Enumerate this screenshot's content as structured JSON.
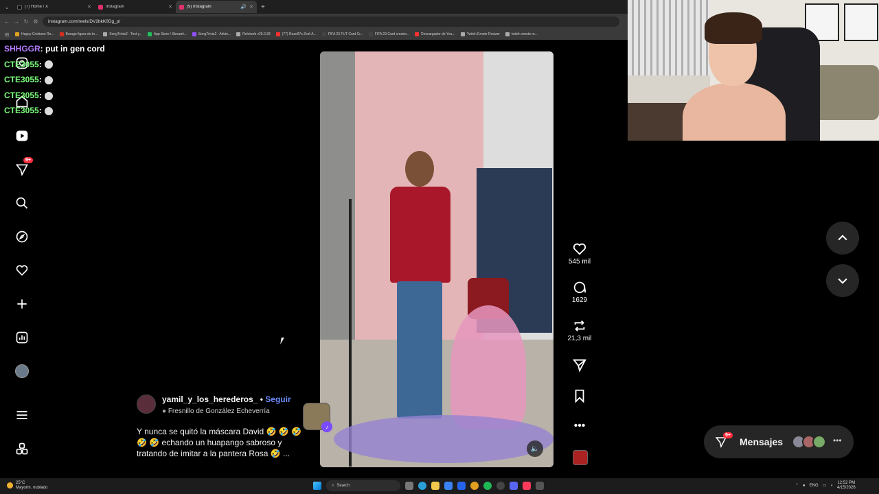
{
  "browser": {
    "tabs": [
      {
        "label": "(7) Home / X",
        "color": "#111111"
      },
      {
        "label": "Instagram",
        "color": "#e1306c"
      },
      {
        "label": "(9) Instagram",
        "color": "#e1306c"
      }
    ],
    "url": "instagram.com/reels/DV2bkK0Dg_p/",
    "bookmarks": [
      {
        "label": "Happy Cristiano Ro...",
        "color": "#e0a020"
      },
      {
        "label": "Burago figura de to...",
        "color": "#d03020"
      },
      {
        "label": "SongTrivia2 - Test y...",
        "color": "#aaaaaa"
      },
      {
        "label": "App Store / Streaml...",
        "color": "#20c060"
      },
      {
        "label": "SongTrivia2 - Advin...",
        "color": "#9050ff"
      },
      {
        "label": "Reletoob v26.0.28",
        "color": "#aaaaaa"
      },
      {
        "label": "(77) Razo97s Zesl-A...",
        "color": "#ff3030"
      },
      {
        "label": "FIFA 23 FUT Card Cr...",
        "color": "#444444"
      },
      {
        "label": "FIFA 23 Card creator...",
        "color": "#444444"
      },
      {
        "label": "Descargador de You...",
        "color": "#ff3030"
      },
      {
        "label": "Twitch Emote Resizer",
        "color": "#aaaaaa"
      },
      {
        "label": "twitch emote re...",
        "color": "#aaaaaa"
      }
    ]
  },
  "chat": [
    {
      "user": "SHHGGR",
      "message": ": put in gen cord",
      "user_color": "#b57bff",
      "emote": false
    },
    {
      "user": "CTE3055",
      "message": ":",
      "user_color": "#7dff7d",
      "emote": true
    },
    {
      "user": "CTE3055",
      "message": ":",
      "user_color": "#7dff7d",
      "emote": true
    },
    {
      "user": "CTE3055",
      "message": ":",
      "user_color": "#7dff7d",
      "emote": true
    },
    {
      "user": "CTE3055",
      "message": ":",
      "user_color": "#7dff7d",
      "emote": true
    }
  ],
  "sidebar": {
    "notification_badge": "9+",
    "icons": [
      "instagram-icon",
      "home-icon",
      "reels-icon",
      "messenger-icon",
      "search-icon",
      "explore-icon",
      "heart-icon",
      "create-icon",
      "dashboard-icon",
      "profile-icon",
      "menu-icon",
      "more-apps-icon"
    ]
  },
  "reel": {
    "actions": {
      "likes": "545 mil",
      "comments": "1629",
      "reposts": "21,3 mil"
    },
    "author": {
      "username": "yamil_y_los_herederos_",
      "separator": " • ",
      "follow_label": "Seguir",
      "location": "Fresnillo de González Echeverría"
    },
    "caption": "Y nunca se quitó la máscara David 🤣 🤣 🤣 🤣 🤣 echando un huapango sabroso y tratando de imitar a la pantera Rosa 🤣 ..."
  },
  "messages": {
    "label": "Mensajes",
    "badge": "9+"
  },
  "taskbar": {
    "weather_temp": "25°C",
    "weather_desc": "Mayorm. nublado",
    "search_label": "Search",
    "language": "ENG",
    "time": "12:52 PM",
    "date": "4/15/2026"
  },
  "colors": {
    "accent_follow": "#6e8cff",
    "badge_red": "#ff3040",
    "background": "#000000"
  }
}
